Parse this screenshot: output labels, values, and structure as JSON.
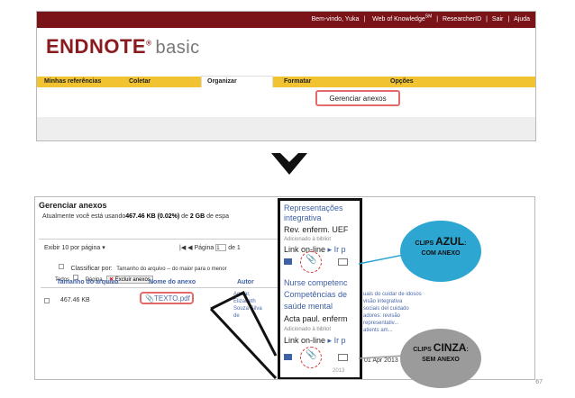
{
  "topbar": {
    "welcome": "Bem-vindo, Yuka",
    "wok": "Web of Knowledge",
    "wok_sup": "SM",
    "links": [
      "ResearcherID",
      "Sair",
      "Ajuda"
    ]
  },
  "logo": {
    "brand": "ENDNOTE",
    "sup": "®",
    "suffix": "basic"
  },
  "tabs": [
    "Minhas referências",
    "Coletar",
    "Organizar",
    "Formatar",
    "Opções"
  ],
  "subnav": {
    "manage": "Gerenciar anexos"
  },
  "manage_panel": {
    "title": "Gerenciar anexos",
    "usage_prefix": "Atualmente você está usando",
    "usage_value": "467.46 KB (0.02%)",
    "usage_mid": " de ",
    "usage_total": "2 GB",
    "usage_suffix": " de espa",
    "per_page": "Exibir 10 por página",
    "pager_label": "Página",
    "pager_value": "1",
    "pager_of": "de 1",
    "sort_label": "Classificar por:",
    "sort_value": "Tamanho do arquivo -- do maior para o menor",
    "todos": "Todos",
    "pagina": "Página",
    "excluir": "Excluir anexos",
    "columns": [
      "Tamanho do arquivo",
      "Nome do anexo",
      "Autor"
    ],
    "row": {
      "size": "467.46 KB",
      "file": "TEXTO.pdf",
      "author": [
        "Aguiar,",
        "Elizabeth",
        "Souza Silva",
        "de"
      ]
    },
    "right_strip": [
      "uais do cuidar de idosos",
      "visão integrativa",
      "sociais del cuidado",
      "adores: revisão",
      "representativ...",
      "atients am..."
    ]
  },
  "zoom": {
    "line1": "Representações",
    "line2": "integrativa",
    "line3": "Rev. enferm. UEF",
    "line4": "Adicionado à bibliot",
    "line5": "Link on-line",
    "line5b": "Ir p",
    "line6": "Nurse competenc",
    "line7": "Competências de",
    "line8": "saúde mental",
    "line9": "Acta paul. enferm",
    "line10": "Adicionado à bibliot",
    "line11": "Link on-line",
    "line11b": "Ir p",
    "date": "01 Apr 2013",
    "date2": "2013"
  },
  "bubbles": {
    "blue": {
      "small": "CLIPS",
      "big": "AZUL",
      "colon": ":",
      "line2": "COM ANEXO",
      "color": "#2da6d1"
    },
    "gray": {
      "small": "CLIPS",
      "big": "CINZA",
      "colon": ":",
      "line2": "SEM ANEXO",
      "color": "#9b9b9b"
    }
  },
  "page_number": "67",
  "colors": {
    "brand": "#7a1418",
    "tabbar": "#f1c331",
    "highlight": "#e46a6a",
    "link": "#4d6aa8"
  }
}
